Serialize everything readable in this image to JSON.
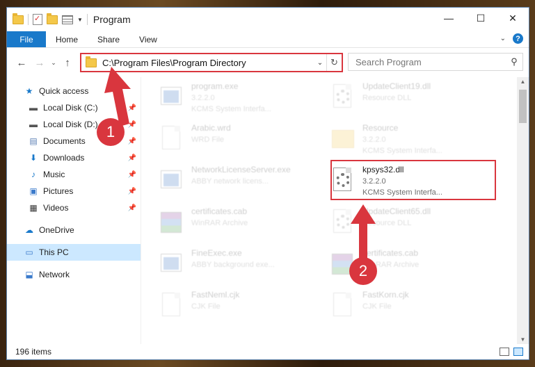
{
  "window": {
    "title": "Program"
  },
  "ribbon": {
    "tabs": [
      "File",
      "Home",
      "Share",
      "View"
    ]
  },
  "address": {
    "path": "C:\\Program Files\\Program Directory"
  },
  "search": {
    "placeholder": "Search Program"
  },
  "sidebar": {
    "items": [
      {
        "label": "Quick access"
      },
      {
        "label": "Local Disk (C:)"
      },
      {
        "label": "Local Disk (D:)"
      },
      {
        "label": "Documents"
      },
      {
        "label": "Downloads"
      },
      {
        "label": "Music"
      },
      {
        "label": "Pictures"
      },
      {
        "label": "Videos"
      },
      {
        "label": "OneDrive"
      },
      {
        "label": "This PC"
      },
      {
        "label": "Network"
      }
    ]
  },
  "files": [
    {
      "name": "program.exe",
      "line1": "3.2.2.0",
      "line2": "KCMS System Interfa..."
    },
    {
      "name": "Arabic.wrd",
      "line1": "WRD File",
      "line2": ""
    },
    {
      "name": "NetworkLicenseServer.exe",
      "line1": "ABBY network licens...",
      "line2": ""
    },
    {
      "name": "certificates.cab",
      "line1": "WinRAR Archive",
      "line2": ""
    },
    {
      "name": "FineExec.exe",
      "line1": "ABBY background exe...",
      "line2": ""
    },
    {
      "name": "FastNeml.cjk",
      "line1": "CJK File",
      "line2": ""
    },
    {
      "name": "UpdateClient19.dll",
      "line1": "Resource DLL",
      "line2": ""
    },
    {
      "name": "Resource",
      "line1": "3.2.2.0",
      "line2": "KCMS System Interfa..."
    },
    {
      "name": "kpsys32.dll",
      "line1": "3.2.2.0",
      "line2": "KCMS System Interfa..."
    },
    {
      "name": "UpdateClient65.dll",
      "line1": "Resource DLL",
      "line2": ""
    },
    {
      "name": "certificates.cab",
      "line1": "WinRAR Archive",
      "line2": ""
    },
    {
      "name": "FastKorn.cjk",
      "line1": "CJK File",
      "line2": ""
    }
  ],
  "status": {
    "count": "196 items"
  },
  "annotations": {
    "step1": "1",
    "step2": "2"
  },
  "colors": {
    "accent": "#1979ca",
    "highlight": "#d9363e",
    "selected": "#cce8ff"
  }
}
